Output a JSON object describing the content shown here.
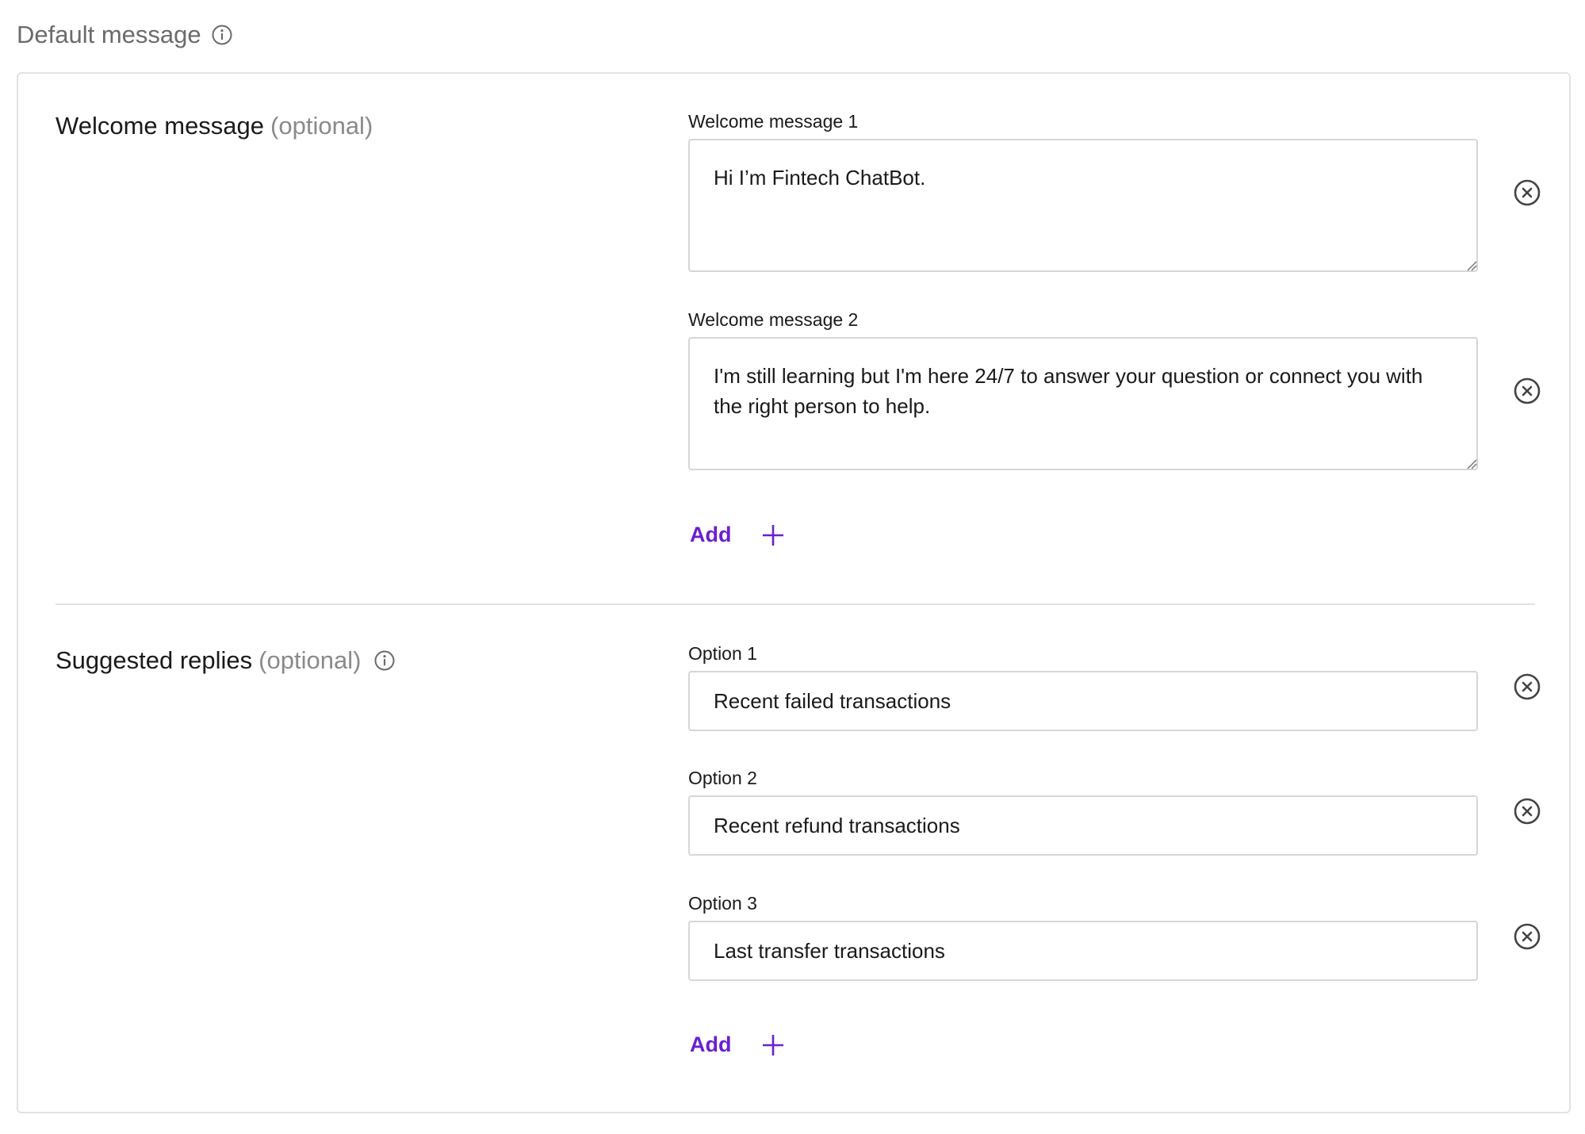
{
  "page": {
    "title": "Default message"
  },
  "welcome": {
    "title": "Welcome message",
    "optional": "(optional)",
    "messages": [
      {
        "label": "Welcome message 1",
        "value": "Hi I’m Fintech ChatBot."
      },
      {
        "label": "Welcome message 2",
        "value": "I'm still learning but I'm here 24/7 to answer your question or connect you with the right person to help."
      }
    ],
    "add_label": "Add"
  },
  "suggested": {
    "title": "Suggested replies",
    "optional": "(optional)",
    "options": [
      {
        "label": "Option 1",
        "value": "Recent failed transactions"
      },
      {
        "label": "Option 2",
        "value": "Recent refund transactions"
      },
      {
        "label": "Option 3",
        "value": "Last transfer transactions"
      }
    ],
    "add_label": "Add"
  },
  "colors": {
    "accent": "#6b1ed1",
    "border": "#d6d6d6",
    "muted_text": "#8a8a8a"
  },
  "icons": {
    "info": "info-icon",
    "remove": "close-circle-icon",
    "add": "plus-icon"
  }
}
